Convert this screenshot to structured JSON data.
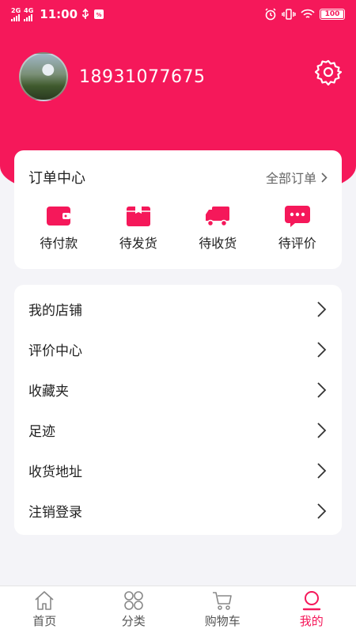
{
  "status_bar": {
    "net1": "2G",
    "net2": "4G",
    "time": "11:00",
    "battery": "100"
  },
  "profile": {
    "phone": "18931077675"
  },
  "orders": {
    "title": "订单中心",
    "all_label": "全部订单",
    "items": [
      {
        "label": "待付款",
        "icon": "wallet-icon"
      },
      {
        "label": "待发货",
        "icon": "package-icon"
      },
      {
        "label": "待收货",
        "icon": "truck-icon"
      },
      {
        "label": "待评价",
        "icon": "chat-bubble-icon"
      }
    ]
  },
  "menu": {
    "items": [
      {
        "label": "我的店铺"
      },
      {
        "label": "评价中心"
      },
      {
        "label": "收藏夹"
      },
      {
        "label": "足迹"
      },
      {
        "label": "收货地址"
      },
      {
        "label": "注销登录"
      }
    ]
  },
  "tabbar": {
    "items": [
      {
        "label": "首页",
        "icon": "home-icon"
      },
      {
        "label": "分类",
        "icon": "category-icon"
      },
      {
        "label": "购物车",
        "icon": "cart-icon"
      },
      {
        "label": "我的",
        "icon": "profile-icon",
        "active": true
      }
    ]
  },
  "colors": {
    "brand": "#f5185a",
    "background": "#f4f4f8"
  }
}
